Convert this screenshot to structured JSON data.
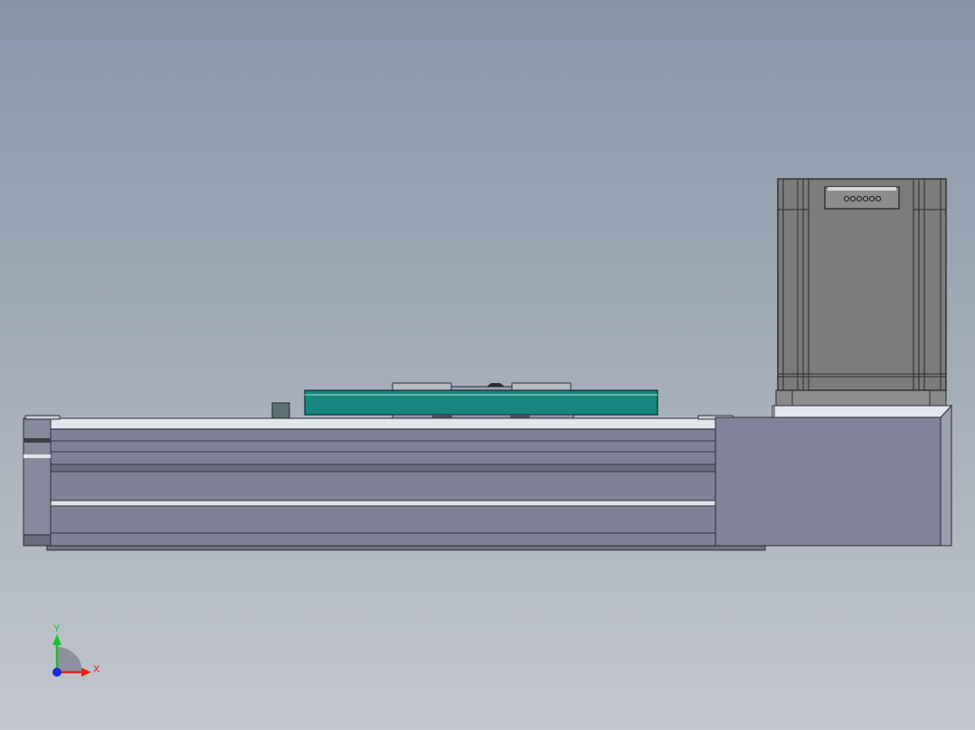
{
  "viewport": {
    "background_top": "#8796a9",
    "background_bottom": "#c3c7cd"
  },
  "model": {
    "rail_color": "#7f8196",
    "carriage_color": "#16867f",
    "motor_color": "#7b7b7b",
    "housing_color": "#80839a"
  },
  "triad": {
    "x_label": "X",
    "y_label": "Y",
    "x_color": "#e8201a",
    "y_color": "#16c22a",
    "z_color": "#1a2cd8"
  }
}
